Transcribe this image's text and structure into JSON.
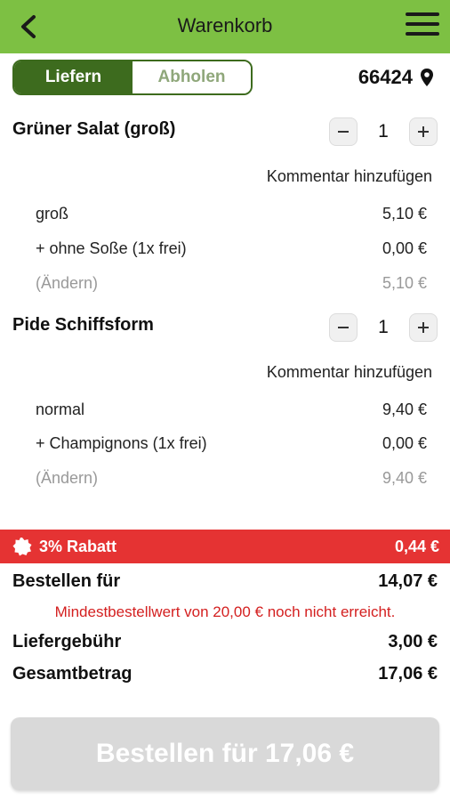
{
  "header": {
    "title": "Warenkorb"
  },
  "mode": {
    "deliver_label": "Liefern",
    "pickup_label": "Abholen",
    "active": "Liefern"
  },
  "location": {
    "zip": "66424"
  },
  "items": [
    {
      "name": "Grüner Salat (groß)",
      "quantity": "1",
      "comment_label": "Kommentar hinzufügen",
      "lines": [
        {
          "label": "groß",
          "price": "5,10 €"
        },
        {
          "label": "+ ohne Soße (1x frei)",
          "price": "0,00 €"
        }
      ],
      "edit_label": "(Ändern)",
      "total": "5,10 €"
    },
    {
      "name": "Pide Schiffsform",
      "quantity": "1",
      "comment_label": "Kommentar hinzufügen",
      "lines": [
        {
          "label": "normal",
          "price": "9,40 €"
        },
        {
          "label": "+ Champignons (1x frei)",
          "price": "0,00 €"
        }
      ],
      "edit_label": "(Ändern)",
      "total": "9,40 €"
    }
  ],
  "discount": {
    "label": "3% Rabatt",
    "amount": "0,44 €"
  },
  "summary": {
    "order_label": "Bestellen für",
    "order_amount": "14,07 €",
    "min_order_warning": "Mindestbestellwert von 20,00 € noch nicht erreicht.",
    "delivery_label": "Liefergebühr",
    "delivery_amount": "3,00 €",
    "total_label": "Gesamtbetrag",
    "total_amount": "17,06 €"
  },
  "order_button": {
    "label": "Bestellen für 17,06 €"
  },
  "colors": {
    "header": "#7dc043",
    "accent": "#3d6b1e",
    "discount": "#e53333",
    "warning": "#d42020",
    "button_disabled": "#d9d9d9"
  },
  "icons": {
    "back": "chevron-left-icon",
    "menu": "hamburger-menu-icon",
    "location": "map-pin-icon",
    "discount": "badge-icon",
    "decrement": "minus-icon",
    "increment": "plus-icon"
  }
}
